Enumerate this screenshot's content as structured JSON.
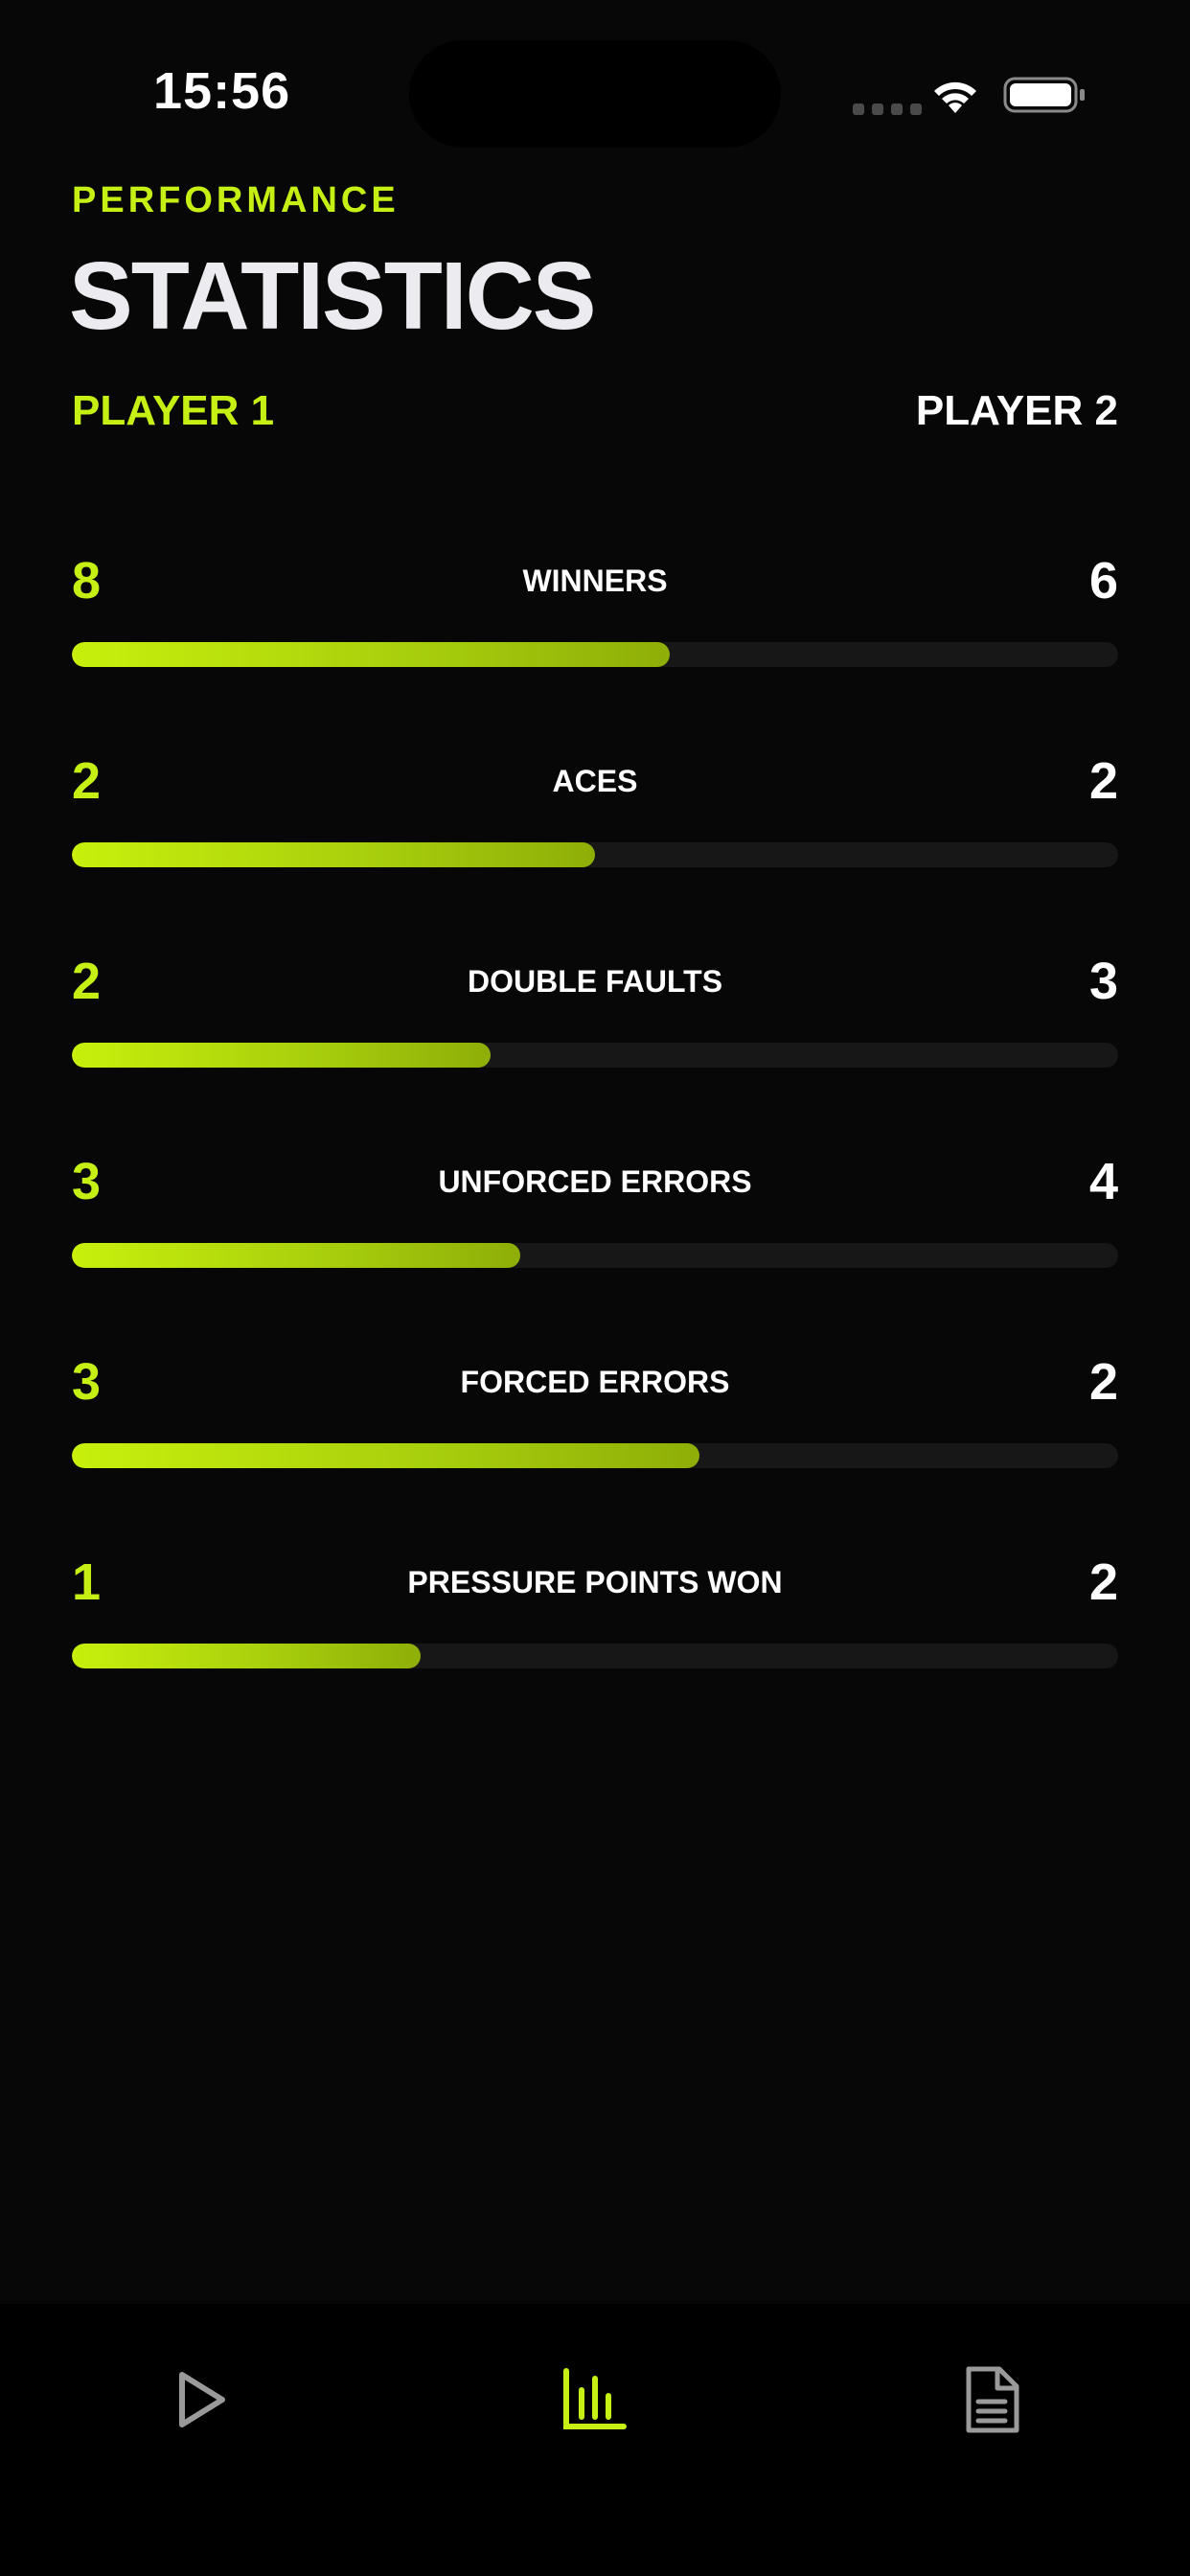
{
  "status_bar": {
    "time": "15:56"
  },
  "header": {
    "eyebrow": "PERFORMANCE",
    "title": "STATISTICS"
  },
  "players": {
    "player1": "PLAYER 1",
    "player2": "PLAYER 2"
  },
  "stats": [
    {
      "label": "WINNERS",
      "p1": "8",
      "p2": "6",
      "p1_share": 0.571
    },
    {
      "label": "ACES",
      "p1": "2",
      "p2": "2",
      "p1_share": 0.5
    },
    {
      "label": "DOUBLE FAULTS",
      "p1": "2",
      "p2": "3",
      "p1_share": 0.4
    },
    {
      "label": "UNFORCED ERRORS",
      "p1": "3",
      "p2": "4",
      "p1_share": 0.429
    },
    {
      "label": "FORCED ERRORS",
      "p1": "3",
      "p2": "2",
      "p1_share": 0.6
    },
    {
      "label": "PRESSURE POINTS WON",
      "p1": "1",
      "p2": "2",
      "p1_share": 0.333
    }
  ],
  "tab_bar": {
    "items": [
      {
        "icon": "play-icon",
        "active": false
      },
      {
        "icon": "bar-chart-icon",
        "active": true
      },
      {
        "icon": "document-icon",
        "active": false
      }
    ]
  },
  "colors": {
    "accent": "#c6ef14",
    "background": "#070707",
    "track": "#171717",
    "inactive_icon": "#9a9a9a"
  }
}
